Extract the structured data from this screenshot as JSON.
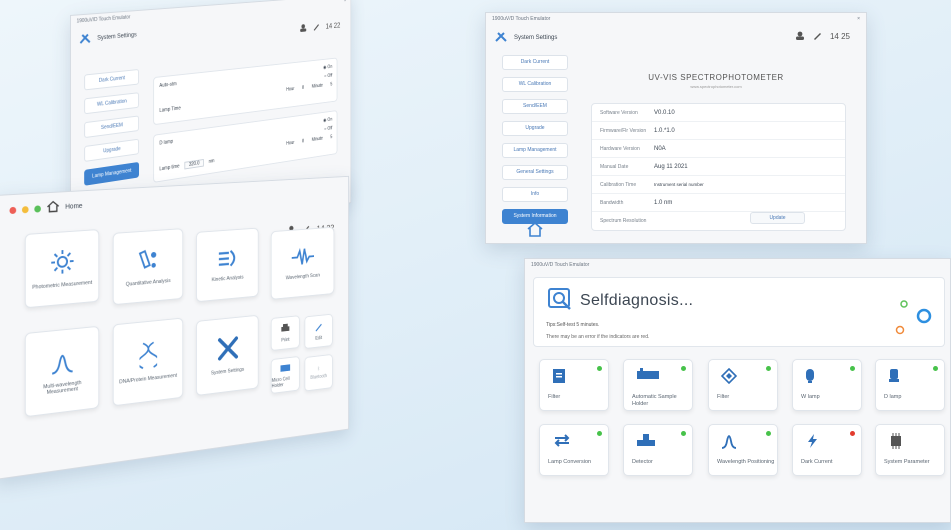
{
  "w1": {
    "title": "1900uV/D Touch Emulator",
    "header": "System Settings",
    "clock": "14 22",
    "sidebar": [
      "Dark Current",
      "WL Calibration",
      "Send/EEM",
      "Upgrade",
      "Lamp Management"
    ],
    "active_index": 4,
    "panel1": {
      "label1": "Auto-stm",
      "label2": "Lamp Time",
      "on": "On",
      "off": "Off",
      "hour": "Hour",
      "hour_val": "0",
      "minute": "Minute",
      "minute_val": "5"
    },
    "panel2": {
      "label1": "D lamp",
      "label2": "Lamp time",
      "on": "On",
      "off": "Off",
      "hour": "Hour",
      "hour_val": "0",
      "minute": "Minute",
      "minute_val": "5",
      "field": "320.0",
      "unit": "nm"
    }
  },
  "w2": {
    "title": "1900uV/D Touch Emulator",
    "home_label": "Home",
    "clock": "14 22",
    "tiles": {
      "photometric": "Photometric Measurement",
      "quantitative": "Quantitative Analysis",
      "kinetic": "Kinetic Analysis",
      "wavelength_scan": "Wavelength Scan",
      "multi_wavelength": "Multi-wavelength Measurement",
      "dna": "DNA/Protein Measurement",
      "settings": "System Settings"
    },
    "mini": {
      "print": "Print",
      "edit": "Edit",
      "micro": "Micro Cell Holder",
      "bluetooth": "Bluetooth"
    }
  },
  "w3": {
    "title": "1900uV/D Touch Emulator",
    "header": "System Settings",
    "clock": "14 25",
    "sidebar": [
      "Dark Current",
      "WL Calibration",
      "Send/EEM",
      "Upgrade",
      "Lamp Management",
      "General Settings",
      "Info",
      "System Information"
    ],
    "active_index": 7,
    "heading": "UV-VIS SPECTROPHOTOMETER",
    "subheading": "www.spectrophotometer.com",
    "rows": [
      {
        "k": "Software Version",
        "v": "V0.0.10"
      },
      {
        "k": "Firmware/Flr Version",
        "v": "1.0.*1.0"
      },
      {
        "k": "Hardware Version",
        "v": "N0A"
      },
      {
        "k": "Manual Date",
        "v": "Aug 11 2021"
      },
      {
        "k": "Calibration Time",
        "v": "Instrument serial number"
      },
      {
        "k": "Bandwidth",
        "v": "1.0 nm"
      },
      {
        "k": "Spectrum Resolution",
        "v": ""
      }
    ],
    "update_label": "Update"
  },
  "w4": {
    "title": "1900uV/D Touch Emulator",
    "self_title": "Selfdiagnosis...",
    "tip1": "Tips:Self-test 5 minutes.",
    "tip2": "There may be an error if the indicators are red.",
    "items": [
      {
        "label": "Filter",
        "status": "ok"
      },
      {
        "label": "Automatic Sample Holder",
        "status": "ok"
      },
      {
        "label": "Filter",
        "status": "ok"
      },
      {
        "label": "W lamp",
        "status": "ok"
      },
      {
        "label": "D lamp",
        "status": "ok"
      },
      {
        "label": "Lamp Conversion",
        "status": "ok"
      },
      {
        "label": "Detector",
        "status": "ok"
      },
      {
        "label": "Wavelength Positioning",
        "status": "ok"
      },
      {
        "label": "Dark Current",
        "status": "error"
      },
      {
        "label": "System Parameter",
        "status": "none"
      }
    ]
  },
  "colors": {
    "accent": "#3e83d1",
    "ok": "#47c24a",
    "error": "#e23b2e",
    "ring_blue": "#2d8fe0",
    "ring_green": "#5fc25a",
    "ring_orange": "#f08a3a"
  }
}
